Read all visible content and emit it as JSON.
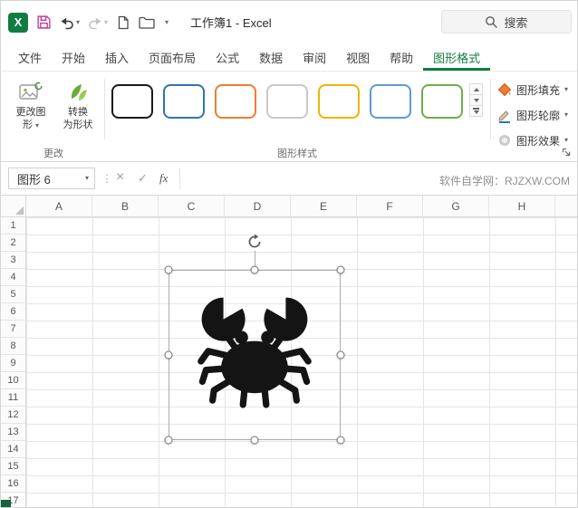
{
  "icons": {
    "chevron_down": "▾",
    "dots": "⋮",
    "cancel": "×",
    "enter": "✓"
  },
  "titlebar": {
    "app_logo_letter": "X",
    "doc_title": "工作簿1 - Excel",
    "search_label": "搜索"
  },
  "ribbon_tabs": [
    {
      "label": "文件",
      "active": false
    },
    {
      "label": "开始",
      "active": false
    },
    {
      "label": "插入",
      "active": false
    },
    {
      "label": "页面布局",
      "active": false
    },
    {
      "label": "公式",
      "active": false
    },
    {
      "label": "数据",
      "active": false
    },
    {
      "label": "审阅",
      "active": false
    },
    {
      "label": "视图",
      "active": false
    },
    {
      "label": "帮助",
      "active": false
    },
    {
      "label": "图形格式",
      "active": true
    }
  ],
  "ribbon": {
    "change_group": {
      "label": "更改",
      "change_shape": {
        "line1": "更改图",
        "line2": "形"
      },
      "convert": {
        "line1": "转换",
        "line2": "为形状"
      }
    },
    "style_group": {
      "label": "图形样式",
      "swatches": [
        {
          "name": "black-outline",
          "color": "#1a1a1a"
        },
        {
          "name": "blue-outline",
          "color": "#2E74B5"
        },
        {
          "name": "orange-outline",
          "color": "#ED7D31"
        },
        {
          "name": "gray-outline",
          "color": "#C9C9C9"
        },
        {
          "name": "gold-outline",
          "color": "#F0B400"
        },
        {
          "name": "lightblue-outline",
          "color": "#5B9BD5"
        },
        {
          "name": "green-outline",
          "color": "#70AD47"
        }
      ]
    },
    "format_group": {
      "fill_label": "图形填充",
      "outline_label": "图形轮廓",
      "effects_label": "图形效果"
    }
  },
  "formula_bar": {
    "name_box_value": "图形 6",
    "fx_label": "fx",
    "watermark": "软件自学网：RJZXW.COM"
  },
  "sheet": {
    "columns": [
      "A",
      "B",
      "C",
      "D",
      "E",
      "F",
      "G",
      "H"
    ],
    "rows": [
      "1",
      "2",
      "3",
      "4",
      "5",
      "6",
      "7",
      "8",
      "9",
      "10",
      "11",
      "12",
      "13",
      "14",
      "15",
      "16",
      "17"
    ],
    "selected_object": "crab-shape"
  },
  "colors": {
    "excel_green": "#107C41",
    "selection_handle_border": "#757575"
  }
}
